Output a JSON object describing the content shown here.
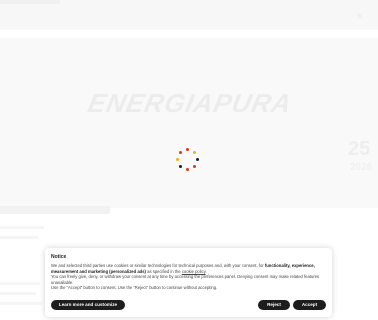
{
  "background": {
    "logo_text": "ENERGIAPURA",
    "big_number": "25",
    "small_number": "2026"
  },
  "spinner": {
    "colors": [
      "#e63312",
      "#1d1d1d",
      "#f2b705"
    ]
  },
  "cookie_banner": {
    "title": "Notice",
    "text_part1": "We and selected third parties use cookies or similar technologies for technical purposes and, with your consent, for ",
    "text_bold": "functionality, experience, measurement and marketing (personalized ads)",
    "text_part2": " as specified in the ",
    "cookie_policy_link": "cookie policy",
    "text_part3": ".",
    "line2": "You can freely give, deny, or withdraw your consent at any time by accessing the preferences panel. Denying consent may make related features unavailable.",
    "line3": "Use the “Accept” button to consent. Use the “Reject” button to continue without accepting.",
    "learn_more_label": "Learn more and customize",
    "reject_label": "Reject",
    "accept_label": "Accept"
  }
}
